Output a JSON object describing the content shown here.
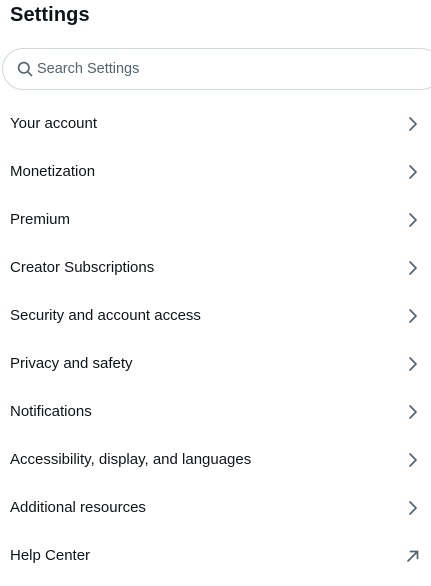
{
  "header": {
    "title": "Settings"
  },
  "search": {
    "placeholder": "Search Settings",
    "value": "",
    "icon": "search-icon"
  },
  "menu": {
    "items": [
      {
        "label": "Your account",
        "icon": "chevron-right-icon"
      },
      {
        "label": "Monetization",
        "icon": "chevron-right-icon"
      },
      {
        "label": "Premium",
        "icon": "chevron-right-icon"
      },
      {
        "label": "Creator Subscriptions",
        "icon": "chevron-right-icon"
      },
      {
        "label": "Security and account access",
        "icon": "chevron-right-icon"
      },
      {
        "label": "Privacy and safety",
        "icon": "chevron-right-icon"
      },
      {
        "label": "Notifications",
        "icon": "chevron-right-icon"
      },
      {
        "label": "Accessibility, display, and languages",
        "icon": "chevron-right-icon"
      },
      {
        "label": "Additional resources",
        "icon": "chevron-right-icon"
      },
      {
        "label": "Help Center",
        "icon": "external-link-arrow-icon"
      }
    ]
  },
  "colors": {
    "text": "#0f1419",
    "placeholder": "#536471",
    "icon": "#536471",
    "border": "#cfd9de"
  }
}
